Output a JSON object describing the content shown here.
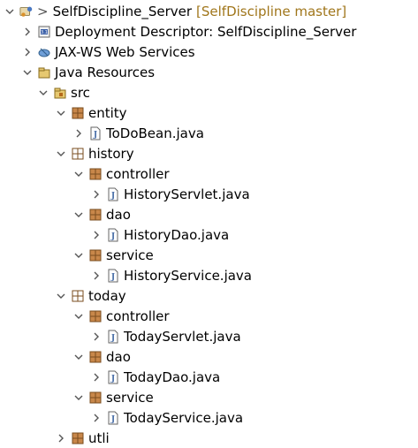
{
  "tree": {
    "project": {
      "prefix": ">",
      "name": "SelfDiscipline_Server",
      "decoration": "[SelfDiscipline master]"
    },
    "deployment_descriptor": "Deployment Descriptor: SelfDiscipline_Server",
    "jaxws": "JAX-WS Web Services",
    "java_resources": "Java Resources",
    "src": "src",
    "entity": {
      "name": "entity",
      "files": [
        "ToDoBean.java"
      ]
    },
    "history": {
      "name": "history",
      "controller": {
        "name": "controller",
        "file": "HistoryServlet.java"
      },
      "dao": {
        "name": "dao",
        "file": "HistoryDao.java"
      },
      "service": {
        "name": "service",
        "file": "HistoryService.java"
      }
    },
    "today": {
      "name": "today",
      "controller": {
        "name": "controller",
        "file": "TodayServlet.java"
      },
      "dao": {
        "name": "dao",
        "file": "TodayDao.java"
      },
      "service": {
        "name": "service",
        "file": "TodayService.java"
      }
    },
    "utli": "utli"
  }
}
